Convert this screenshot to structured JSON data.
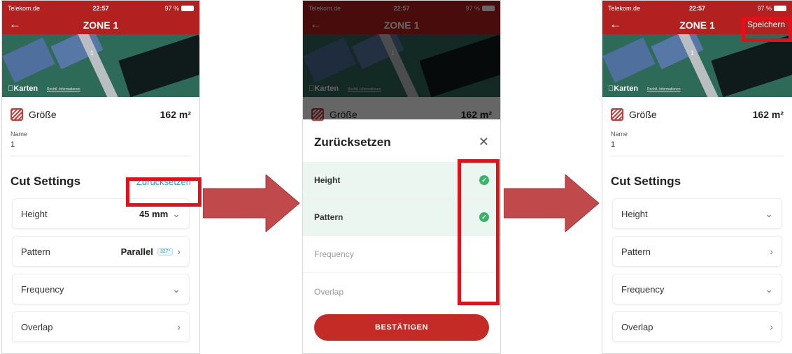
{
  "status": {
    "carrier": "Telekom.de",
    "time": "22:57",
    "battery": "97 %"
  },
  "zone_title": "ZONE 1",
  "map": {
    "label": "Karten",
    "legal": "Rechtl. Informationen",
    "zone_number": "1"
  },
  "size": {
    "label": "Größe",
    "value": "162 m²"
  },
  "name_field": {
    "label": "Name",
    "value": "1"
  },
  "cut_settings": {
    "title": "Cut Settings",
    "reset_label": "Zurücksetzen"
  },
  "settings_screen1": {
    "height": {
      "label": "Height",
      "value": "45 mm"
    },
    "pattern": {
      "label": "Pattern",
      "value": "Parallel",
      "badge": "327°"
    },
    "frequency": {
      "label": "Frequency"
    },
    "overlap": {
      "label": "Overlap"
    }
  },
  "reset_sheet": {
    "title": "Zurücksetzen",
    "options": [
      {
        "label": "Height",
        "selected": true
      },
      {
        "label": "Pattern",
        "selected": true
      },
      {
        "label": "Frequency",
        "selected": false
      },
      {
        "label": "Overlap",
        "selected": false
      }
    ],
    "confirm_label": "BESTÄTIGEN"
  },
  "screen3": {
    "save_label": "Speichern"
  },
  "colors": {
    "brand_red": "#b32020",
    "highlight_red": "#e3101a",
    "arrow_red": "#c0494b",
    "link_blue": "#1e9bd7",
    "check_green": "#39b46a"
  }
}
